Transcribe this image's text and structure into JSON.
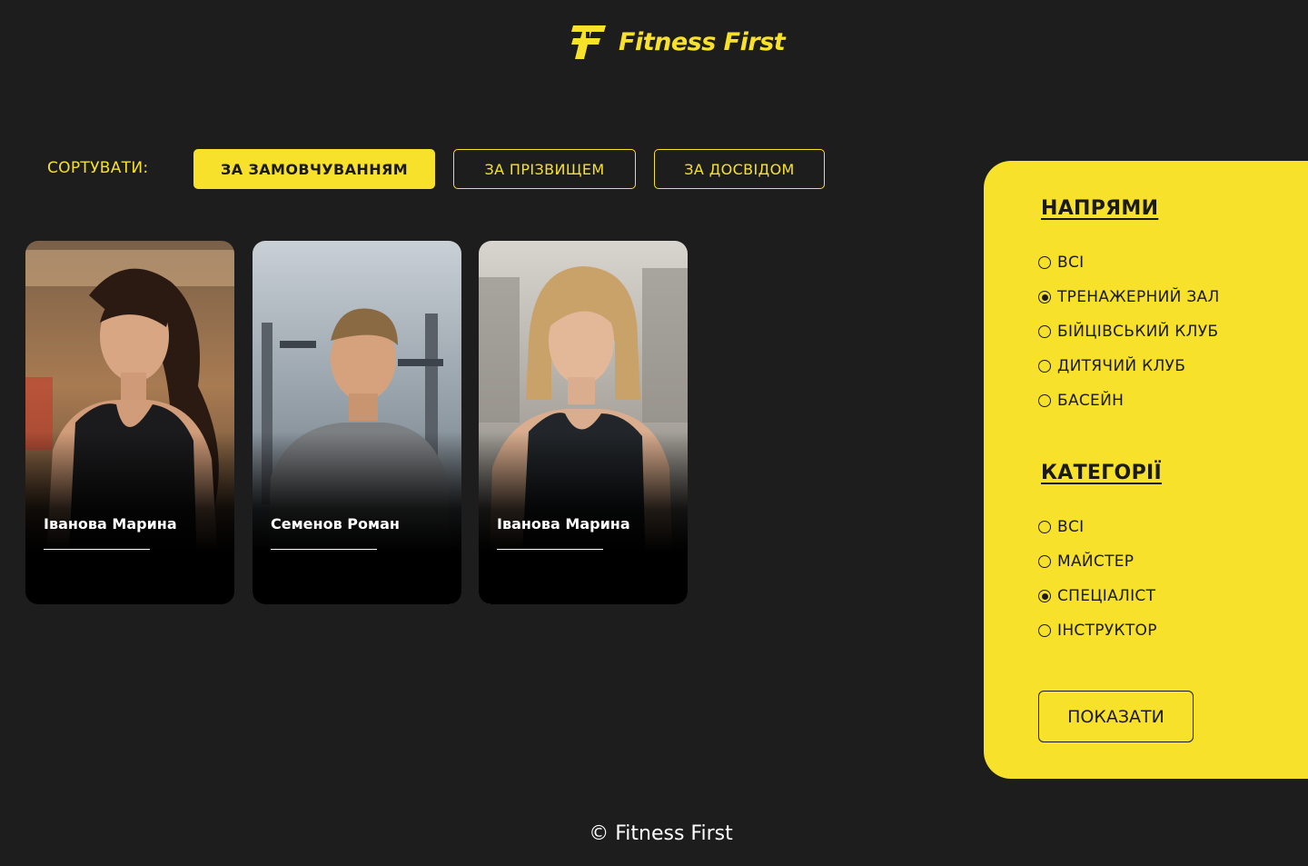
{
  "brand": {
    "name": "Fitness First",
    "accent_color": "#f7e12a",
    "icon": "fitness-first-logo-icon"
  },
  "sort": {
    "label": "СОРТУВАТИ:",
    "options": [
      {
        "label": "ЗА ЗАМОВЧУВАННЯМ",
        "active": true
      },
      {
        "label": "ЗА ПРІЗВИЩЕМ",
        "active": false
      },
      {
        "label": "ЗА ДОСВІДОМ",
        "active": false
      }
    ]
  },
  "trainers": [
    {
      "name": "Іванова Марина"
    },
    {
      "name": "Семенов Роман"
    },
    {
      "name": "Іванова Марина"
    }
  ],
  "filters": {
    "directions": {
      "title": "НАПРЯМИ",
      "options": [
        {
          "label": "ВСІ",
          "selected": false
        },
        {
          "label": "ТРЕНАЖЕРНИЙ ЗАЛ",
          "selected": true
        },
        {
          "label": "БІЙЦІВСЬКИЙ КЛУБ",
          "selected": false
        },
        {
          "label": "ДИТЯЧИЙ КЛУБ",
          "selected": false
        },
        {
          "label": "БАСЕЙН",
          "selected": false
        }
      ]
    },
    "categories": {
      "title": "КАТЕГОРІЇ",
      "options": [
        {
          "label": "ВСІ",
          "selected": false
        },
        {
          "label": "МАЙСТЕР",
          "selected": false
        },
        {
          "label": "СПЕЦІАЛІСТ",
          "selected": true
        },
        {
          "label": "ІНСТРУКТОР",
          "selected": false
        }
      ]
    },
    "submit_label": "ПОКАЗАТИ"
  },
  "footer": {
    "text": "© Fitness First"
  }
}
